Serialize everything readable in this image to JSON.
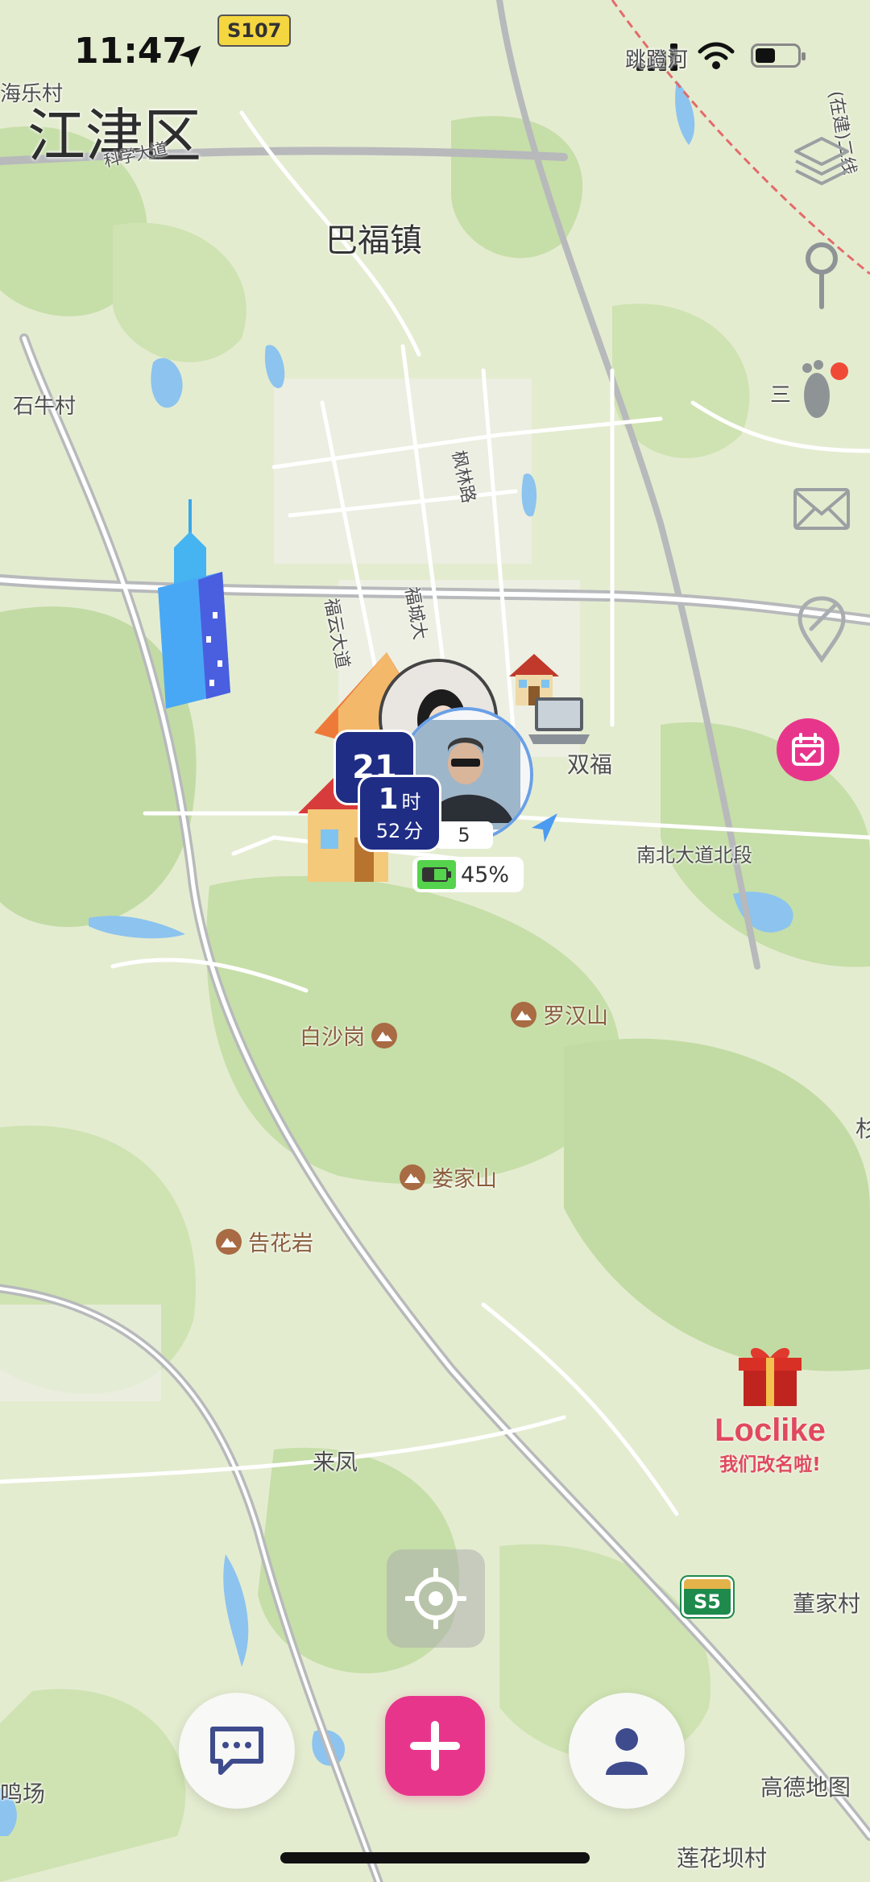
{
  "status_bar": {
    "time": "11:47",
    "road_badge": "S107"
  },
  "map": {
    "district_title": "江津区",
    "labels": {
      "hai_le_cun": "海乐村",
      "keji_road": "科学大道",
      "ba_fu_zhen": "巴福镇",
      "shi_niu_cun": "石牛村",
      "feng_lin_lu": "枫林路",
      "fu_yun_da_dao": "福云大道",
      "fu_cheng_da": "福城大",
      "shuang_fu": "双福",
      "nan_bei_da_dao": "南北大道北段",
      "san_label": "三",
      "tiao_label": "跳蹬河",
      "rail_label": "(在建)二线",
      "lai_feng": "来凤",
      "dong_jia_cun": "董家村",
      "ming_chang": "鸣场",
      "lian_hua_ba_cun": "莲花坝村",
      "edge_label": "杉",
      "amap_watermark": "高德地图",
      "s5_badge": "S5"
    },
    "pois": {
      "luo_han_shan": "罗汉山",
      "bai_sha_gang": "白沙岗",
      "lou_jia_shan": "娄家山",
      "gao_hua_yan": "告花岩"
    }
  },
  "friends": {
    "cluster_count": "21",
    "duration_hours": "1",
    "duration_hour_unit": "时",
    "duration_minutes": "52",
    "duration_minute_unit": "分",
    "battery_percent": "45%",
    "battery_level": 0.45,
    "partial_label": "5"
  },
  "promo": {
    "brand": "Loclike",
    "subtitle": "我们改名啦!"
  },
  "icons": {
    "layers": "layers-icon",
    "pin": "pin-icon",
    "footprint": "footprint-icon",
    "mail": "mail-icon",
    "tag": "tag-icon",
    "calendar": "calendar-icon",
    "locate": "locate-icon",
    "chat": "chat-icon",
    "add": "add-icon",
    "profile": "profile-icon",
    "gift": "gift-icon"
  },
  "colors": {
    "accent_pink": "#e8358c",
    "badge_blue": "#1f2d85",
    "battery_green": "#55d34c"
  }
}
